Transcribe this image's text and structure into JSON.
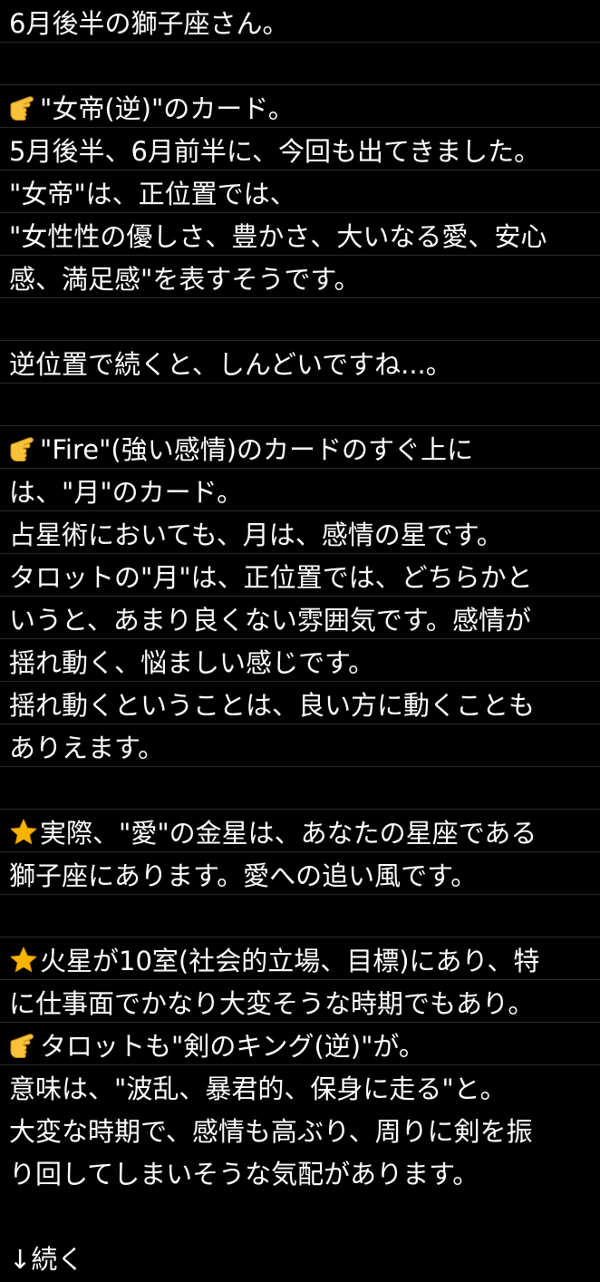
{
  "memo": {
    "lines": [
      {
        "text": "6月後半の獅子座さん。"
      },
      {
        "text": ""
      },
      {
        "icon": "pointing-hand-icon",
        "text": "\"女帝(逆)\"のカード。"
      },
      {
        "text": "5月後半、6月前半に、今回も出てきました。"
      },
      {
        "text": "\"女帝\"は、正位置では、"
      },
      {
        "text": "\"女性性の優しさ、豊かさ、大いなる愛、安心"
      },
      {
        "text": "感、満足感\"を表すそうです。"
      },
      {
        "text": ""
      },
      {
        "text": "逆位置で続くと、しんどいですね...。"
      },
      {
        "text": ""
      },
      {
        "icon": "pointing-hand-icon",
        "text": "\"Fire\"(強い感情)のカードのすぐ上に"
      },
      {
        "text": "は、\"月\"のカード。"
      },
      {
        "text": "占星術においても、月は、感情の星です。"
      },
      {
        "text": "タロットの\"月\"は、正位置では、どちらかと"
      },
      {
        "text": "いうと、あまり良くない雰囲気です。感情が"
      },
      {
        "text": "揺れ動く、悩ましい感じです。"
      },
      {
        "text": "揺れ動くということは、良い方に動くことも"
      },
      {
        "text": "ありえます。"
      },
      {
        "text": ""
      },
      {
        "icon": "star-icon",
        "text": "実際、\"愛\"の金星は、あなたの星座である"
      },
      {
        "text": "獅子座にあります。愛への追い風です。"
      },
      {
        "text": ""
      },
      {
        "icon": "star-icon",
        "text": "火星が10室(社会的立場、目標)にあり、特"
      },
      {
        "text": "に仕事面でかなり大変そうな時期でもあり。"
      },
      {
        "icon": "pointing-hand-icon",
        "text": "タロットも\"剣のキング(逆)\"が。"
      },
      {
        "text": "意味は、\"波乱、暴君的、保身に走る\"と。"
      },
      {
        "text": "大変な時期で、感情も高ぶり、周りに剣を振"
      },
      {
        "text": "り回してしまいそうな気配があります。"
      },
      {
        "text": ""
      },
      {
        "text": "↓続く"
      }
    ]
  },
  "colors": {
    "background": "#000000",
    "text": "#ffffff",
    "rule": "#2a2a2a",
    "hand": "#f7c23a",
    "star": "#f5b400"
  }
}
